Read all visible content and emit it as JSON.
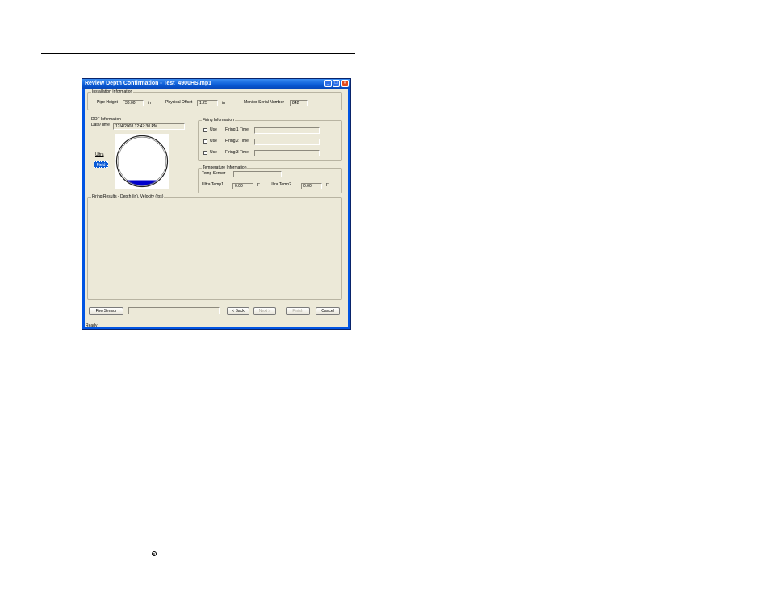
{
  "window": {
    "title": "Review Depth Confirmation - Test_4900HS\\mp1",
    "minimize_icon": "minimize-icon",
    "maximize_icon": "maximize-icon",
    "close_icon": "close-icon",
    "title_color": "#0a5bd6"
  },
  "installation": {
    "group_title": "Installation Information",
    "pipe_height_label": "Pipe Height",
    "pipe_height_value": "36.00",
    "pipe_height_unit": "in",
    "physical_offset_label": "Physical Offset",
    "physical_offset_value": "1.25",
    "physical_offset_unit": "in",
    "serial_label": "Monitor Serial Number",
    "serial_value": "842"
  },
  "dof": {
    "group_title": "DOF Information",
    "datetime_label": "Date/Time",
    "datetime_value": "12/4/2008 12:47:30 PM",
    "ultra_label": "Ultra",
    "badge_label": "Field",
    "fill_color": "#0000cc"
  },
  "firing": {
    "group_title": "Firing Information",
    "rows": [
      {
        "use_label": "Use",
        "time_label": "Firing 1 Time",
        "value": ""
      },
      {
        "use_label": "Use",
        "time_label": "Firing 2 Time",
        "value": ""
      },
      {
        "use_label": "Use",
        "time_label": "Firing 3 Time",
        "value": ""
      }
    ]
  },
  "temperature": {
    "group_title": "Temperature Information",
    "sensor_label": "Temp Sensor",
    "sensor_value": "",
    "ultra_temp1_label": "Ultra Temp1",
    "ultra_temp1_value": "0.00",
    "ultra_temp1_unit": "F",
    "ultra_temp2_label": "Ultra Temp2",
    "ultra_temp2_value": "0.00",
    "ultra_temp2_unit": "F"
  },
  "results": {
    "group_title": "Firing Results - Depth (in), Velocity (fps)"
  },
  "buttons": {
    "fire_sensor": "Fire Sensor",
    "back": "< Back",
    "next": "Next >",
    "finish": "Finish",
    "cancel": "Cancel"
  },
  "status": {
    "text": "Ready"
  }
}
